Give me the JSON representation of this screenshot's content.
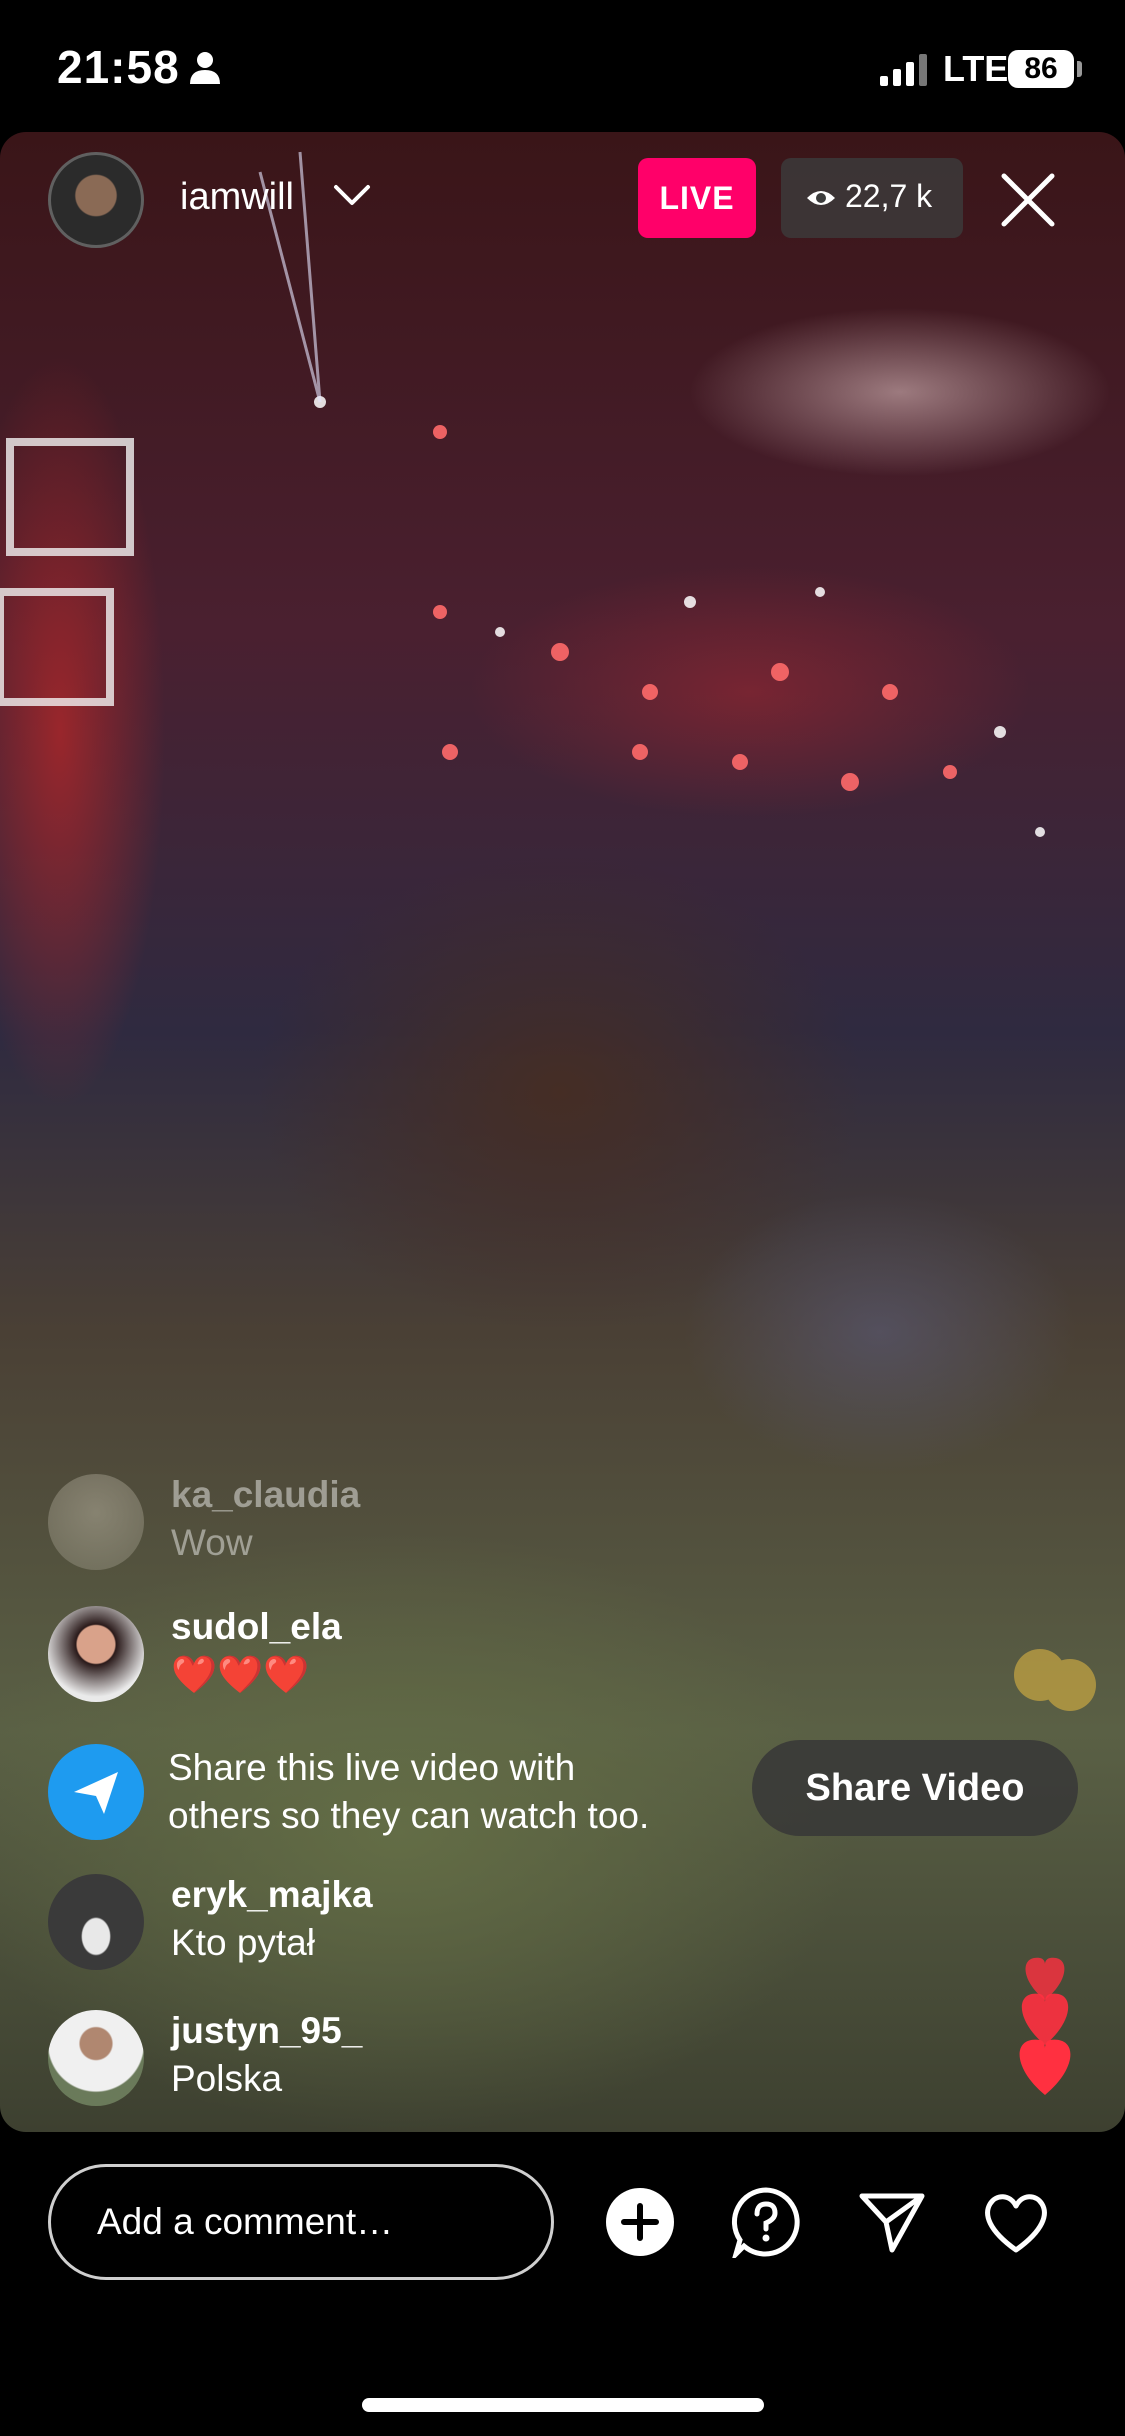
{
  "status_bar": {
    "time": "21:58",
    "carrier": "LTE",
    "battery": "86"
  },
  "header": {
    "host_name": "iamwill",
    "live_label": "LIVE",
    "viewers": "22,7 k"
  },
  "comments": [
    {
      "user": "ka_claudia",
      "text": "Wow"
    },
    {
      "user": "sudol_ela",
      "text": "❤️❤️❤️"
    }
  ],
  "share_prompt": {
    "line1": "Share this live video with",
    "line2": "others so they can watch too.",
    "button": "Share Video"
  },
  "comments_after": [
    {
      "user": "eryk_majka",
      "text": "Kto pytał"
    },
    {
      "user": "justyn_95_",
      "text": "Polska"
    }
  ],
  "bottom_bar": {
    "comment_placeholder": "Add a comment…"
  },
  "colors": {
    "live": "#ff0069",
    "share_blue": "#1e9bf0",
    "heart_red": "#ff3040"
  }
}
